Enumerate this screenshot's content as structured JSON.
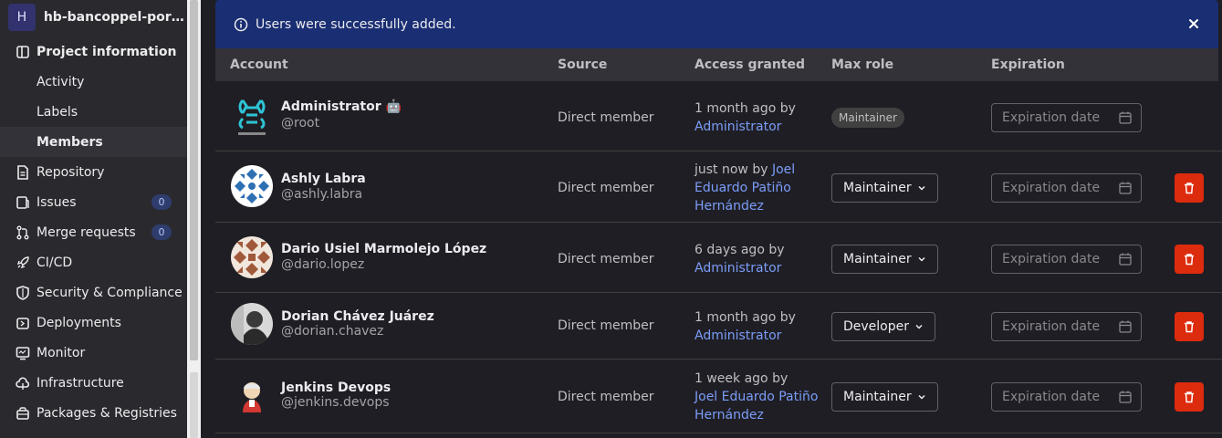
{
  "sidebar": {
    "project_initial": "H",
    "project_name": "hb-bancoppel-portal-f...",
    "items": [
      {
        "label": "Project information"
      },
      {
        "label": "Activity"
      },
      {
        "label": "Labels"
      },
      {
        "label": "Members"
      },
      {
        "label": "Repository"
      },
      {
        "label": "Issues",
        "badge": "0"
      },
      {
        "label": "Merge requests",
        "badge": "0"
      },
      {
        "label": "CI/CD"
      },
      {
        "label": "Security & Compliance"
      },
      {
        "label": "Deployments"
      },
      {
        "label": "Monitor"
      },
      {
        "label": "Infrastructure"
      },
      {
        "label": "Packages & Registries"
      }
    ]
  },
  "alert": {
    "message": "Users were successfully added."
  },
  "table": {
    "headers": {
      "account": "Account",
      "source": "Source",
      "access": "Access granted",
      "role": "Max role",
      "expiration": "Expiration"
    },
    "rows": [
      {
        "name": "Administrator 🤖",
        "username": "@root",
        "source": "Direct member",
        "granted_text": "1 month ago by",
        "granted_by": "Administrator",
        "role": "Maintainer",
        "expiration_placeholder": "Expiration date"
      },
      {
        "name": "Ashly Labra",
        "username": "@ashly.labra",
        "source": "Direct member",
        "granted_text": "just now by",
        "granted_by": "Joel Eduardo Patiño Hernández",
        "role": "Maintainer",
        "expiration_placeholder": "Expiration date"
      },
      {
        "name": "Dario Usiel Marmolejo López",
        "username": "@dario.lopez",
        "source": "Direct member",
        "granted_text": "6 days ago by",
        "granted_by": "Administrator",
        "role": "Maintainer",
        "expiration_placeholder": "Expiration date"
      },
      {
        "name": "Dorian Chávez Juárez",
        "username": "@dorian.chavez",
        "source": "Direct member",
        "granted_text": "1 month ago by",
        "granted_by": "Administrator",
        "role": "Developer",
        "expiration_placeholder": "Expiration date"
      },
      {
        "name": "Jenkins Devops",
        "username": "@jenkins.devops",
        "source": "Direct member",
        "granted_text": "1 week ago by",
        "granted_by": "Joel Eduardo Patiño Hernández",
        "role": "Maintainer",
        "expiration_placeholder": "Expiration date"
      }
    ]
  }
}
